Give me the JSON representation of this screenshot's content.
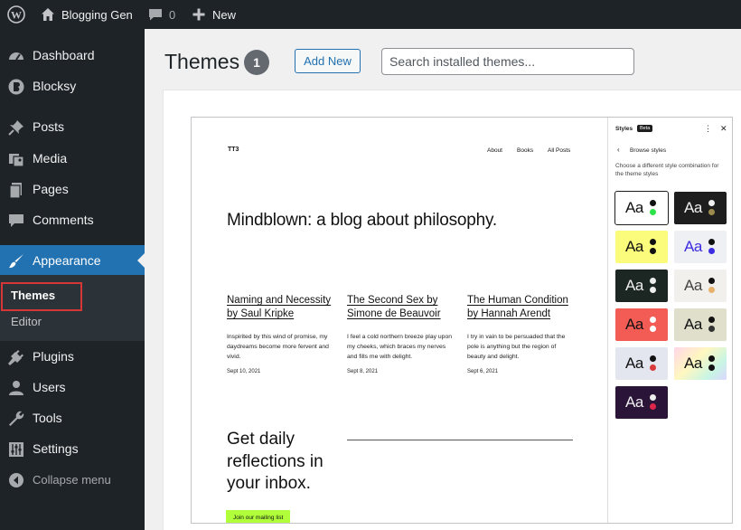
{
  "adminbar": {
    "site_name": "Blogging Gen",
    "comments_count": "0",
    "new_label": "New"
  },
  "sidebar": {
    "items": [
      {
        "label": "Dashboard",
        "icon": "dashboard-icon"
      },
      {
        "label": "Blocksy",
        "icon": "blocksy-icon"
      },
      {
        "label": "Posts",
        "icon": "pushpin-icon"
      },
      {
        "label": "Media",
        "icon": "media-icon"
      },
      {
        "label": "Pages",
        "icon": "pages-icon"
      },
      {
        "label": "Comments",
        "icon": "comment-bubble-icon"
      },
      {
        "label": "Appearance",
        "icon": "paintbrush-icon"
      },
      {
        "label": "Plugins",
        "icon": "plug-icon"
      },
      {
        "label": "Users",
        "icon": "user-icon"
      },
      {
        "label": "Tools",
        "icon": "wrench-icon"
      },
      {
        "label": "Settings",
        "icon": "settings-sliders-icon"
      }
    ],
    "submenu": [
      {
        "label": "Themes"
      },
      {
        "label": "Editor"
      }
    ],
    "collapse_label": "Collapse menu"
  },
  "main": {
    "title": "Themes",
    "count": "1",
    "add_new_label": "Add New",
    "search_placeholder": "Search installed themes..."
  },
  "preview": {
    "site_name": "TT3",
    "nav": [
      "About",
      "Books",
      "All Posts"
    ],
    "hero": "Mindblown: a blog about philosophy.",
    "posts": [
      {
        "title": "Naming and Necessity by Saul Kripke",
        "excerpt": "Inspirited by this wind of promise, my daydreams become more fervent and vivid.",
        "date": "Sept 10, 2021"
      },
      {
        "title": "The Second Sex by Simone de Beauvoir",
        "excerpt": "I feel a cold northern breeze play upon my cheeks, which braces my nerves and fills me with delight.",
        "date": "Sept 8, 2021"
      },
      {
        "title": "The Human Condition by Hannah Arendt",
        "excerpt": "I try in vain to be persuaded that the pole is anything but the region of beauty and delight.",
        "date": "Sept 6, 2021"
      }
    ],
    "newsletter": "Get daily reflections in your inbox.",
    "newsletter_button": "Join our mailing list"
  },
  "styles_panel": {
    "title": "Styles",
    "badge": "Beta",
    "subtitle": "Browse styles",
    "description": "Choose a different style combination for the theme styles",
    "swatch_text": "Aa",
    "swatches": [
      {
        "bg": "#ffffff",
        "fg": "#111111",
        "dot1": "#111111",
        "dot2": "#2ee34a",
        "border": "#1e1e1e"
      },
      {
        "bg": "#1e1e1e",
        "fg": "#f0f0f0",
        "dot1": "#f0f0f0",
        "dot2": "#9d8b4e",
        "border": ""
      },
      {
        "bg": "#fcfc7c",
        "fg": "#111111",
        "dot1": "#111111",
        "dot2": "#111111",
        "border": ""
      },
      {
        "bg": "#eef0f4",
        "fg": "#3d2de0",
        "dot1": "#111111",
        "dot2": "#3d2de0",
        "border": ""
      },
      {
        "bg": "#1c2622",
        "fg": "#eeeeee",
        "dot1": "#eeeeee",
        "dot2": "#eeeeee",
        "border": ""
      },
      {
        "bg": "#f2f0ec",
        "fg": "#444444",
        "dot1": "#111111",
        "dot2": "#e7b06b",
        "border": ""
      },
      {
        "bg": "#f25c54",
        "fg": "#111111",
        "dot1": "#ffffff",
        "dot2": "#ffffff",
        "border": ""
      },
      {
        "bg": "#e0dfcc",
        "fg": "#111111",
        "dot1": "#111111",
        "dot2": "#333333",
        "border": ""
      },
      {
        "bg": "#e4e6ef",
        "fg": "#111111",
        "dot1": "#111111",
        "dot2": "#d83a3a",
        "border": ""
      },
      {
        "bg": "gradient",
        "fg": "#111111",
        "dot1": "#111111",
        "dot2": "#111111",
        "border": ""
      },
      {
        "bg": "#2a1438",
        "fg": "#eeeeee",
        "dot1": "#eeeeee",
        "dot2": "#e0254a",
        "border": ""
      }
    ]
  }
}
